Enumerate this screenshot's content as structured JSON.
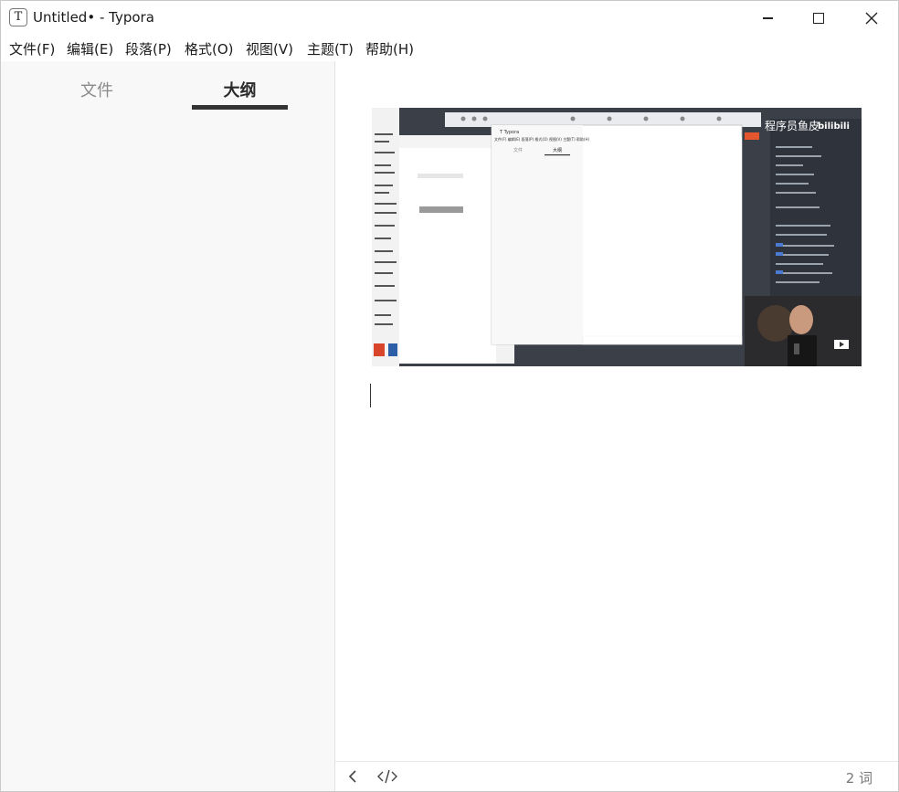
{
  "window": {
    "icon_letter": "T",
    "title": "Untitled• - Typora"
  },
  "menu": {
    "items": [
      "文件(F)",
      "编辑(E)",
      "段落(P)",
      "格式(O)",
      "视图(V)",
      "主题(T)",
      "帮助(H)"
    ]
  },
  "sidebar": {
    "tab_files": "文件",
    "tab_outline": "大纲",
    "active_tab": "大纲"
  },
  "status": {
    "word_count": "2 词"
  },
  "embedded_image": {
    "inner_window_title": "Typora",
    "inner_menu": [
      "文件(F)",
      "编辑(E)",
      "段落(P)",
      "格式(O)",
      "视图(V)",
      "主题(T)",
      "帮助(H)"
    ],
    "inner_tab_files": "文件",
    "inner_tab_outline": "大纲",
    "overlay_text": "程序员鱼皮",
    "overlay_logo": "bilibili"
  },
  "icons": {
    "app": "typora-icon",
    "minimize": "minimize-icon",
    "maximize": "maximize-icon",
    "close": "close-icon",
    "back": "chevron-left-icon",
    "source": "source-code-icon"
  }
}
